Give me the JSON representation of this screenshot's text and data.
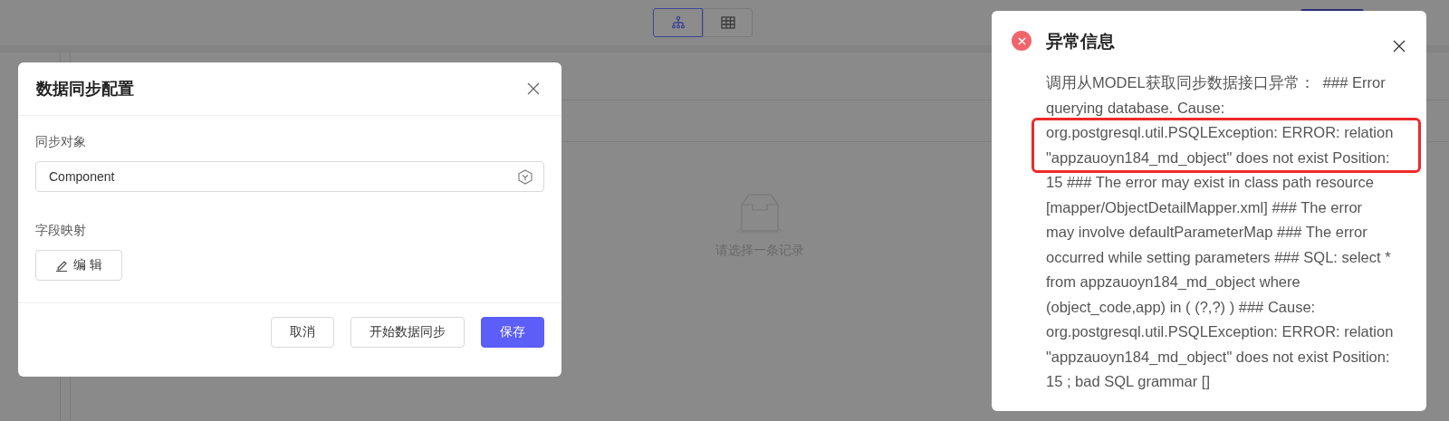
{
  "toolbar": {
    "view_toggle": [
      {
        "kind": "tree",
        "selected": true
      },
      {
        "kind": "table",
        "selected": false
      }
    ]
  },
  "empty_state": {
    "text": "请选择一条记录"
  },
  "sync_dialog": {
    "title": "数据同步配置",
    "fields": [
      {
        "label": "同步对象",
        "kind": "select",
        "value": "Component"
      },
      {
        "label": "字段映射",
        "kind": "button",
        "button": "编 辑"
      }
    ],
    "buttons": [
      {
        "label": "取消",
        "kind": "default"
      },
      {
        "label": "开始数据同步",
        "kind": "default"
      },
      {
        "label": "保存",
        "kind": "primary"
      }
    ]
  },
  "error_dialog": {
    "title": "异常信息",
    "message_lines": [
      {
        "text": "调用从MODEL获取同步数据接口异常：  ### Error",
        "highlighted": false
      },
      {
        "text": "querying database. Cause:",
        "highlighted": false
      },
      {
        "text": "org.postgresql.util.PSQLException: ERROR: relation",
        "highlighted": true
      },
      {
        "text": "\"appzauoyn184_md_object\" does not exist Position:",
        "highlighted": true
      },
      {
        "text": "15 ### The error may exist in class path resource",
        "highlighted": false
      },
      {
        "text": "[mapper/ObjectDetailMapper.xml] ### The error",
        "highlighted": false
      },
      {
        "text": "may involve defaultParameterMap ### The error",
        "highlighted": false
      },
      {
        "text": "occurred while setting parameters ### SQL: select *",
        "highlighted": false
      },
      {
        "text": "from appzauoyn184_md_object where",
        "highlighted": false
      },
      {
        "text": "(object_code,app) in ( (?,?) ) ### Cause:",
        "highlighted": false
      },
      {
        "text": "org.postgresql.util.PSQLException: ERROR: relation",
        "highlighted": false
      },
      {
        "text": "\"appzauoyn184_md_object\" does not exist Position:",
        "highlighted": false
      },
      {
        "text": "15 ; bad SQL grammar []",
        "highlighted": false
      }
    ]
  }
}
